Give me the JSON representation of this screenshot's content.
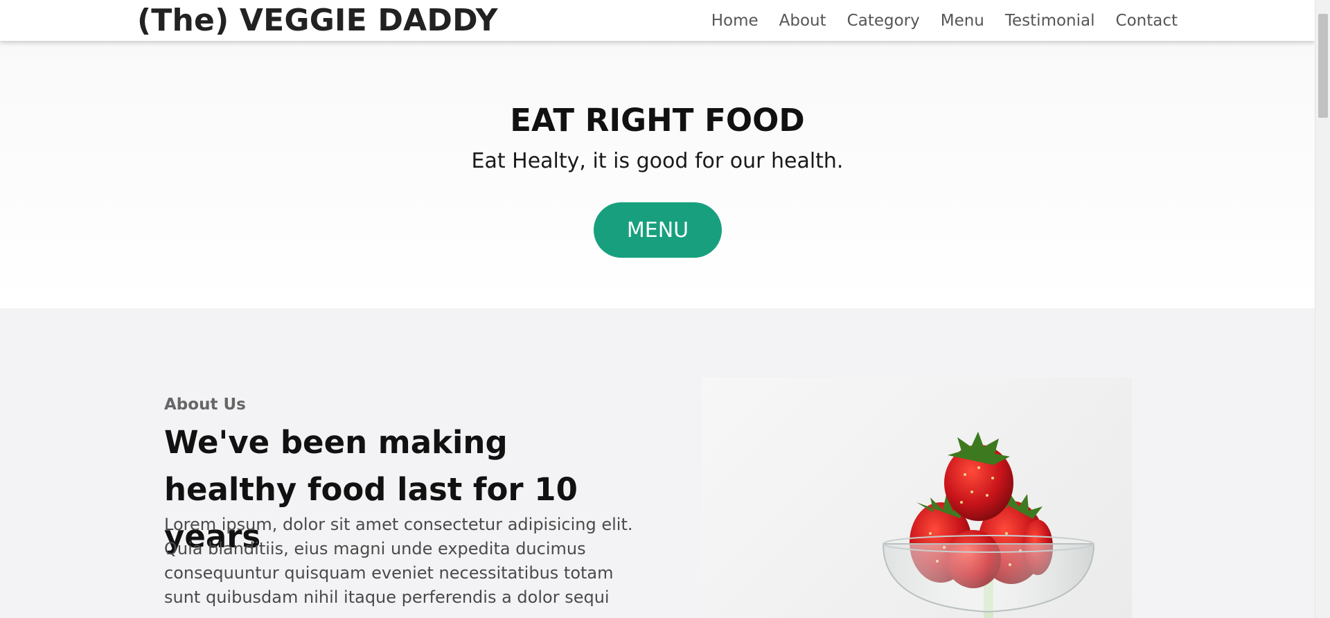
{
  "header": {
    "logo": "(The) VEGGIE DADDY",
    "nav": [
      {
        "label": "Home"
      },
      {
        "label": "About"
      },
      {
        "label": "Category"
      },
      {
        "label": "Menu"
      },
      {
        "label": "Testimonial"
      },
      {
        "label": "Contact"
      }
    ]
  },
  "hero": {
    "title": "EAT RIGHT FOOD",
    "subtitle": "Eat Healty, it is good for our health.",
    "button_label": "MENU"
  },
  "about": {
    "eyebrow": "About Us",
    "heading": "We've been making healthy food last for 10 years",
    "body": "Lorem ipsum, dolor sit amet consectetur adipisicing elit. Quia blanditiis, eius magni unde expedita ducimus consequuntur quisquam eveniet necessitatibus totam sunt quibusdam nihil itaque perferendis a dolor sequi"
  },
  "colors": {
    "accent": "#18a07e",
    "hero_title": "#111111",
    "about_background": "#f3f3f5"
  },
  "icons": {
    "about_image": "strawberries-in-glass-image"
  }
}
